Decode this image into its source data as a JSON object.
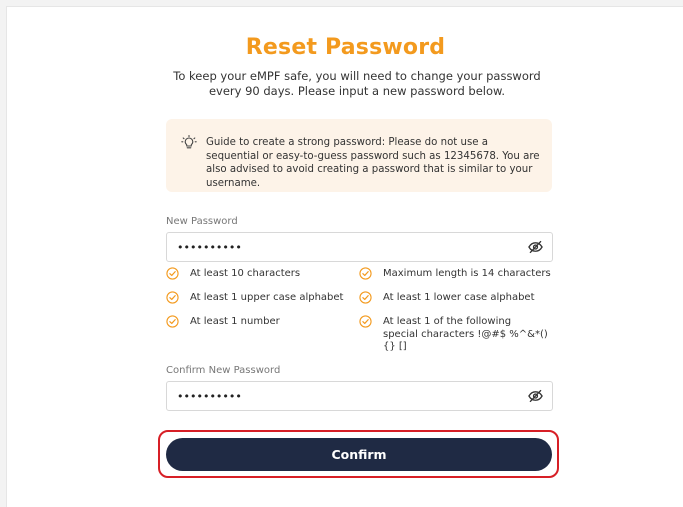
{
  "page": {
    "title": "Reset Password",
    "subtitle": "To keep your eMPF safe, you will need to change your password every 90 days. Please input a new password below."
  },
  "guide": {
    "icon": "lightbulb-icon",
    "text": "Guide to create a strong password: Please do not use a sequential or easy-to-guess password such as 12345678. You are also advised to avoid creating a password that is similar to your username."
  },
  "new_password": {
    "label": "New Password",
    "value": "••••••••••",
    "toggle_icon": "eye-slash-icon"
  },
  "rules": [
    {
      "text": "At least 10 characters",
      "met": true
    },
    {
      "text": "Maximum length is 14 characters",
      "met": true
    },
    {
      "text": "At least 1 upper case alphabet",
      "met": true
    },
    {
      "text": "At least 1 lower case alphabet",
      "met": true
    },
    {
      "text": "At least 1 number",
      "met": true
    },
    {
      "text": "At least 1 of the following special characters !@#$ %^&*(){} []",
      "met": true
    }
  ],
  "confirm_password": {
    "label": "Confirm New Password",
    "value": "••••••••••",
    "toggle_icon": "eye-slash-icon"
  },
  "confirm_button": {
    "label": "Confirm"
  },
  "colors": {
    "accent": "#f39a1e",
    "guide_bg": "#fdf3e8",
    "button_bg": "#1f2a44",
    "highlight": "#d71f26"
  }
}
